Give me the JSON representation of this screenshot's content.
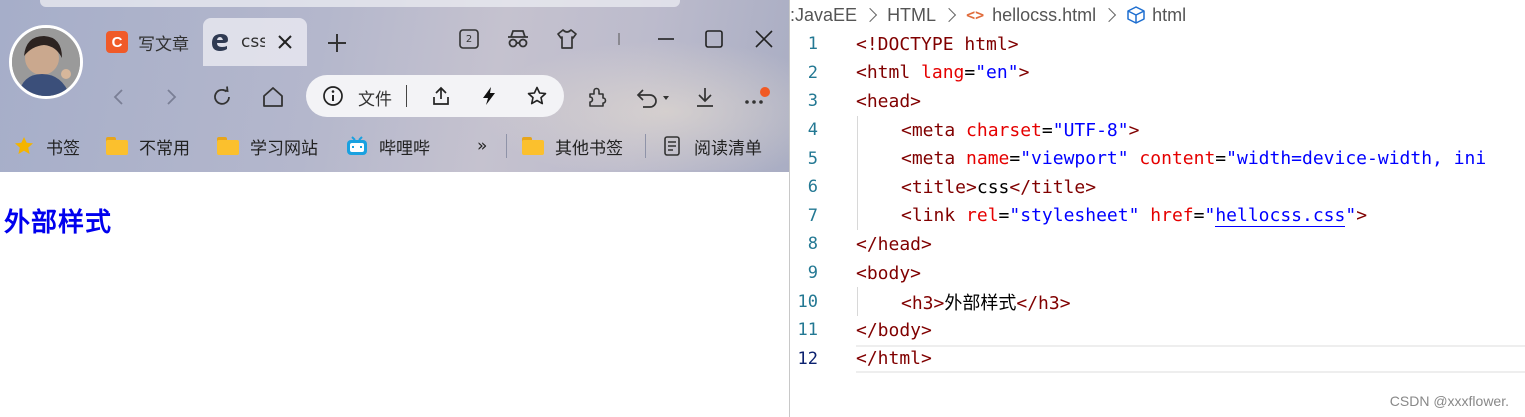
{
  "browser": {
    "tabs": [
      {
        "title": "写文章",
        "favicon": "C"
      },
      {
        "title": "css",
        "active": true
      }
    ],
    "tab_counter": "2",
    "address": {
      "file_label": "文件"
    },
    "bookmarks": [
      {
        "label": "书签",
        "icon": "star-icon"
      },
      {
        "label": "不常用",
        "icon": "folder-icon"
      },
      {
        "label": "学习网站",
        "icon": "folder-icon"
      },
      {
        "label": "哔哩哔",
        "icon": "bilibili-icon"
      },
      {
        "label": "其他书签",
        "icon": "folder-icon"
      },
      {
        "label": "阅读清单",
        "icon": "reading-list-icon"
      }
    ],
    "overflow": "»",
    "page": {
      "h3": "外部样式"
    }
  },
  "editor": {
    "breadcrumbs": [
      ": ",
      "JavaEE",
      "HTML",
      "hellocss.html",
      "html"
    ],
    "file_icon": "<>",
    "current_line": 12,
    "lines": [
      {
        "n": "1"
      },
      {
        "n": "2"
      },
      {
        "n": "3"
      },
      {
        "n": "4"
      },
      {
        "n": "5"
      },
      {
        "n": "6"
      },
      {
        "n": "7"
      },
      {
        "n": "8"
      },
      {
        "n": "9"
      },
      {
        "n": "10"
      },
      {
        "n": "11"
      },
      {
        "n": "12"
      }
    ],
    "code": {
      "l1_tag": "<!DOCTYPE",
      "l1_word": " html",
      "l1_end": ">",
      "l2_open": "<html",
      "l2_attr": " lang",
      "l2_eq": "=",
      "l2_val": "\"en\"",
      "l2_end": ">",
      "l3": "<head>",
      "l4_open": "<meta",
      "l4_attr": " charset",
      "l4_eq": "=",
      "l4_val": "\"UTF-8\"",
      "l4_end": ">",
      "l5_open": "<meta",
      "l5_attr1": " name",
      "l5_eq1": "=",
      "l5_val1": "\"viewport\"",
      "l5_attr2": " content",
      "l5_eq2": "=",
      "l5_val2": "\"width=device-width, ini",
      "l6_open": "<title>",
      "l6_text": "css",
      "l6_close": "</title>",
      "l7_open": "<link",
      "l7_attr1": " rel",
      "l7_eq1": "=",
      "l7_val1": "\"stylesheet\"",
      "l7_attr2": " href",
      "l7_eq2": "=",
      "l7_q1": "\"",
      "l7_link": "hellocss.css",
      "l7_q2": "\"",
      "l7_end": ">",
      "l8": "</head>",
      "l9": "<body>",
      "l10_open": "<h3>",
      "l10_text": "外部样式",
      "l10_close": "</h3>",
      "l11": "</body>",
      "l12": "</html>"
    }
  },
  "watermark": "CSDN @xxxflower.",
  "colors": {
    "link": "#0000ee",
    "tag": "#800000",
    "attr": "#e50000",
    "value": "#0000ff",
    "line_number": "#237893"
  }
}
